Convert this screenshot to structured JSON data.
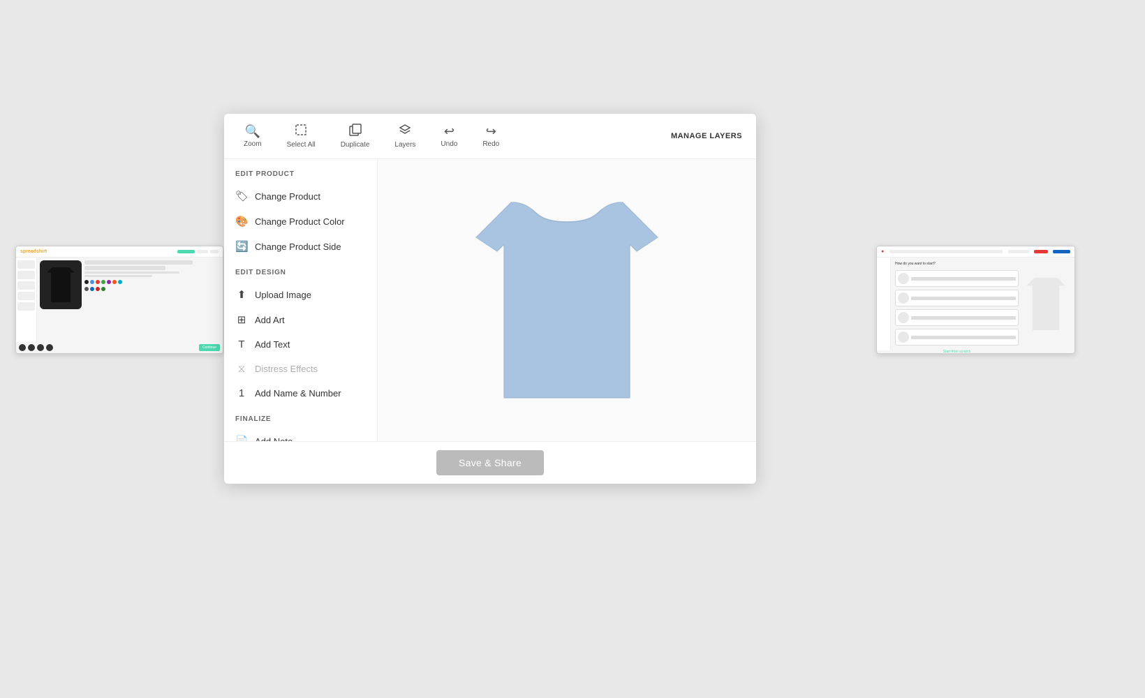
{
  "page": {
    "background_color": "#e8e8e8"
  },
  "toolbar": {
    "zoom_label": "Zoom",
    "select_all_label": "Select All",
    "duplicate_label": "Duplicate",
    "layers_label": "Layers",
    "undo_label": "Undo",
    "redo_label": "Redo",
    "manage_layers_label": "MANAGE LAYERS"
  },
  "left_panel": {
    "edit_product_title": "EDIT PRODUCT",
    "change_product_label": "Change Product",
    "change_product_color_label": "Change Product Color",
    "change_product_side_label": "Change Product Side",
    "edit_design_title": "EDIT DESIGN",
    "upload_image_label": "Upload Image",
    "add_art_label": "Add Art",
    "add_text_label": "Add Text",
    "distress_effects_label": "Distress Effects",
    "add_name_number_label": "Add Name & Number",
    "finalize_title": "FINALIZE",
    "add_note_label": "Add Note"
  },
  "save_button": {
    "label": "Save & Share"
  },
  "tshirt": {
    "color": "#a8c4e0"
  }
}
